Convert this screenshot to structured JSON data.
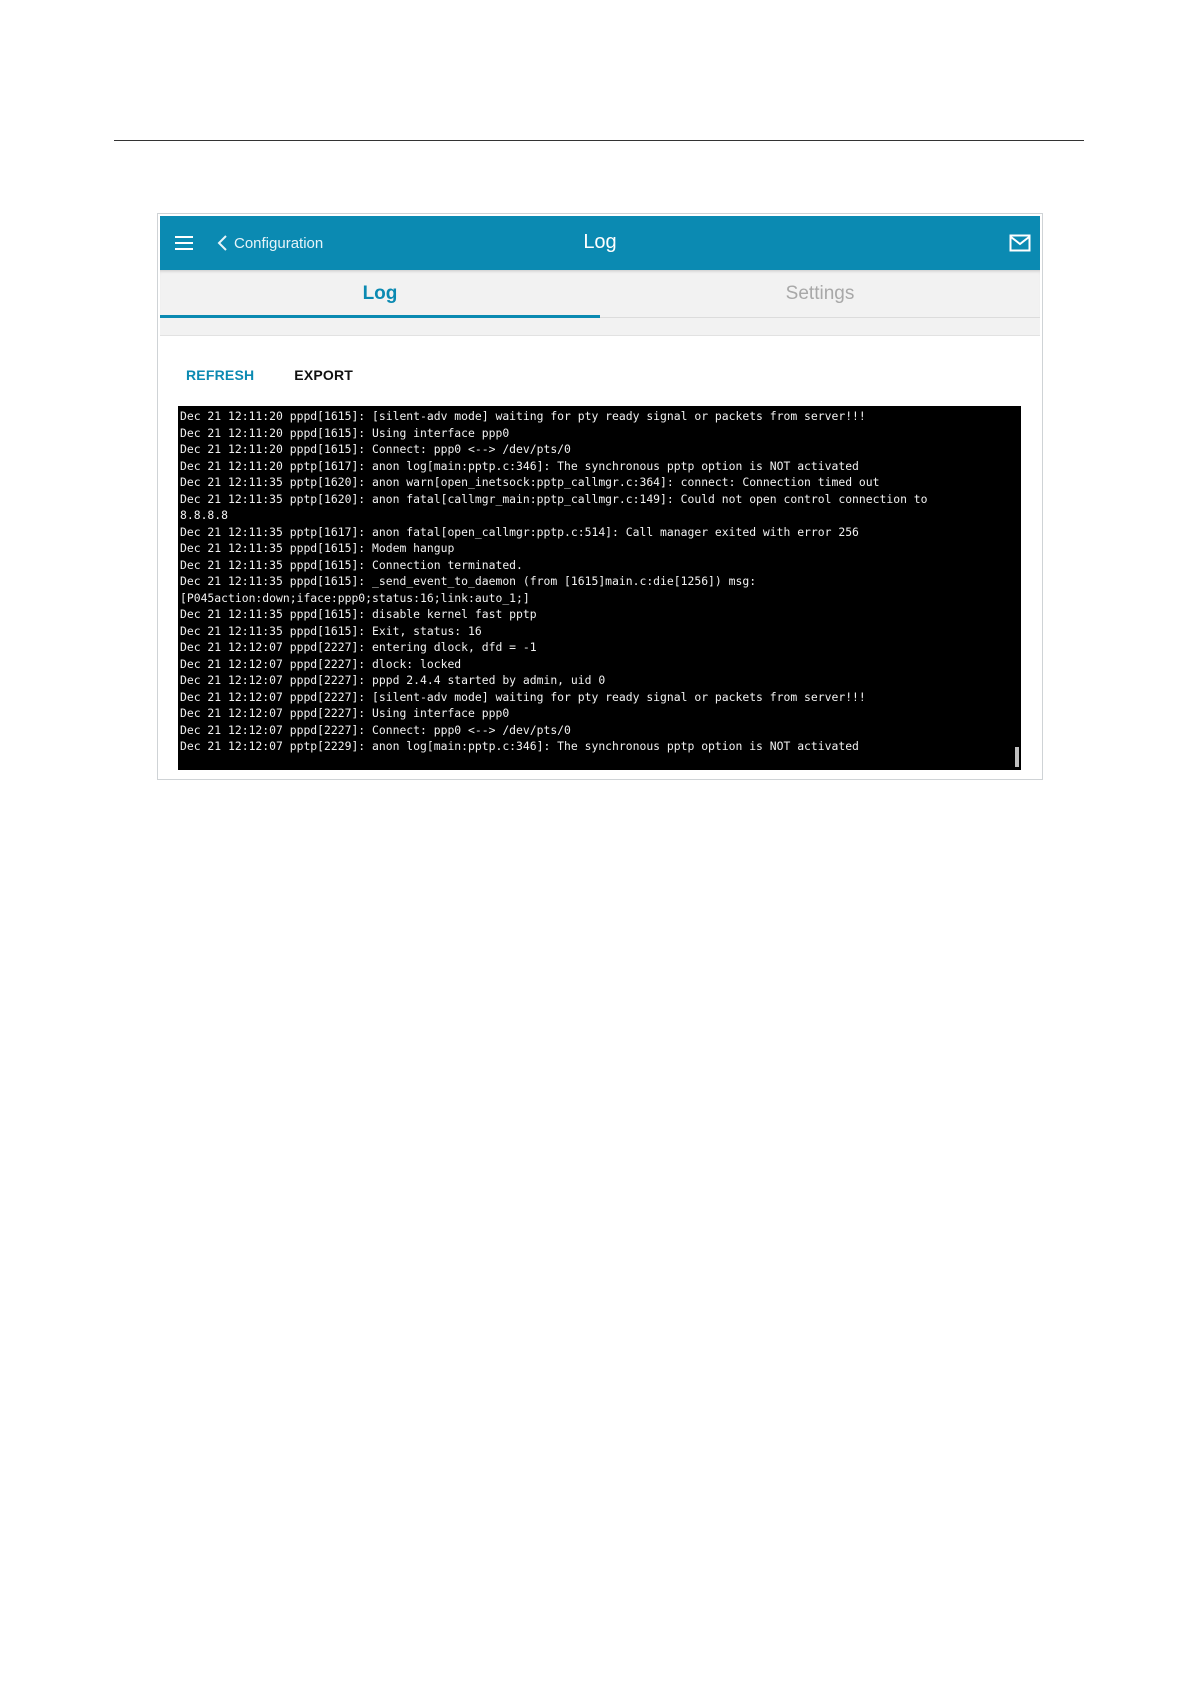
{
  "header": {
    "back_label": "Configuration",
    "title": "Log",
    "icons": {
      "menu": "hamburger-menu-icon",
      "back": "chevron-left-icon",
      "notifications": "mail-icon"
    }
  },
  "tabs": [
    {
      "label": "Log",
      "active": true
    },
    {
      "label": "Settings",
      "active": false
    }
  ],
  "actions": {
    "refresh_label": "REFRESH",
    "export_label": "EXPORT"
  },
  "log_lines": [
    "Dec 21 12:11:20 pppd[1615]: [silent-adv mode] waiting for pty ready signal or packets from server!!!",
    "Dec 21 12:11:20 pppd[1615]: Using interface ppp0",
    "Dec 21 12:11:20 pppd[1615]: Connect: ppp0 <--> /dev/pts/0",
    "Dec 21 12:11:20 pptp[1617]: anon log[main:pptp.c:346]: The synchronous pptp option is NOT activated",
    "Dec 21 12:11:35 pptp[1620]: anon warn[open_inetsock:pptp_callmgr.c:364]: connect: Connection timed out",
    "Dec 21 12:11:35 pptp[1620]: anon fatal[callmgr_main:pptp_callmgr.c:149]: Could not open control connection to",
    "8.8.8.8",
    "Dec 21 12:11:35 pptp[1617]: anon fatal[open_callmgr:pptp.c:514]: Call manager exited with error 256",
    "Dec 21 12:11:35 pppd[1615]: Modem hangup",
    "Dec 21 12:11:35 pppd[1615]: Connection terminated.",
    "Dec 21 12:11:35 pppd[1615]: _send_event_to_daemon (from [1615]main.c:die[1256]) msg:",
    "[P045action:down;iface:ppp0;status:16;link:auto_1;]",
    "Dec 21 12:11:35 pppd[1615]: disable kernel fast pptp",
    "Dec 21 12:11:35 pppd[1615]: Exit, status: 16",
    "Dec 21 12:12:07 pppd[2227]: entering dlock, dfd = -1",
    "Dec 21 12:12:07 pppd[2227]: dlock: locked",
    "Dec 21 12:12:07 pppd[2227]: pppd 2.4.4 started by admin, uid 0",
    "Dec 21 12:12:07 pppd[2227]: [silent-adv mode] waiting for pty ready signal or packets from server!!!",
    "Dec 21 12:12:07 pppd[2227]: Using interface ppp0",
    "Dec 21 12:12:07 pppd[2227]: Connect: ppp0 <--> /dev/pts/0",
    "Dec 21 12:12:07 pptp[2229]: anon log[main:pptp.c:346]: The synchronous pptp option is NOT activated"
  ],
  "colors": {
    "accent": "#0b8ab2",
    "console_background": "#000000",
    "console_text": "#f2f2f2"
  }
}
